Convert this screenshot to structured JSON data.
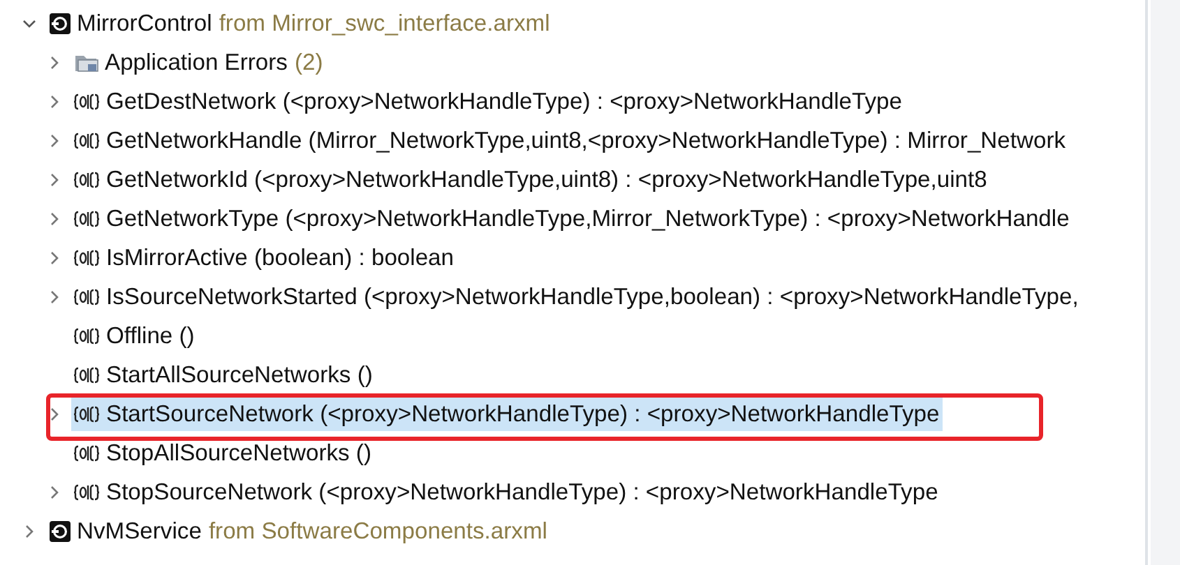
{
  "tree": [
    {
      "kind": "component",
      "label": "MirrorControl",
      "source": "from Mirror_swc_interface.arxml",
      "expandable": true,
      "expanded": true,
      "children": [
        {
          "kind": "folder",
          "label": "Application Errors",
          "count": "(2)",
          "expandable": true,
          "expanded": false,
          "selected": false,
          "annotated": false
        },
        {
          "kind": "operation",
          "label": "GetDestNetwork (<proxy>NetworkHandleType) : <proxy>NetworkHandleType",
          "expandable": true,
          "expanded": false,
          "selected": false,
          "annotated": false
        },
        {
          "kind": "operation",
          "label": "GetNetworkHandle (Mirror_NetworkType,uint8,<proxy>NetworkHandleType) : Mirror_Network",
          "expandable": true,
          "expanded": false,
          "selected": false,
          "annotated": false
        },
        {
          "kind": "operation",
          "label": "GetNetworkId (<proxy>NetworkHandleType,uint8) : <proxy>NetworkHandleType,uint8",
          "expandable": true,
          "expanded": false,
          "selected": false,
          "annotated": false
        },
        {
          "kind": "operation",
          "label": "GetNetworkType (<proxy>NetworkHandleType,Mirror_NetworkType) : <proxy>NetworkHandle",
          "expandable": true,
          "expanded": false,
          "selected": false,
          "annotated": false
        },
        {
          "kind": "operation",
          "label": "IsMirrorActive (boolean) : boolean",
          "expandable": true,
          "expanded": false,
          "selected": false,
          "annotated": false
        },
        {
          "kind": "operation",
          "label": "IsSourceNetworkStarted (<proxy>NetworkHandleType,boolean) : <proxy>NetworkHandleType,",
          "expandable": true,
          "expanded": false,
          "selected": false,
          "annotated": false
        },
        {
          "kind": "operation",
          "label": "Offline ()",
          "expandable": false,
          "selected": false,
          "annotated": false
        },
        {
          "kind": "operation",
          "label": "StartAllSourceNetworks ()",
          "expandable": false,
          "selected": false,
          "annotated": false
        },
        {
          "kind": "operation",
          "label": "StartSourceNetwork (<proxy>NetworkHandleType) : <proxy>NetworkHandleType",
          "expandable": true,
          "expanded": false,
          "selected": true,
          "annotated": true
        },
        {
          "kind": "operation",
          "label": "StopAllSourceNetworks ()",
          "expandable": false,
          "selected": false,
          "annotated": false
        },
        {
          "kind": "operation",
          "label": "StopSourceNetwork (<proxy>NetworkHandleType) : <proxy>NetworkHandleType",
          "expandable": true,
          "expanded": false,
          "selected": false,
          "annotated": false
        }
      ]
    },
    {
      "kind": "component",
      "label": "NvMService",
      "source": "from SoftwareComponents.arxml",
      "expandable": true,
      "expanded": false
    }
  ]
}
